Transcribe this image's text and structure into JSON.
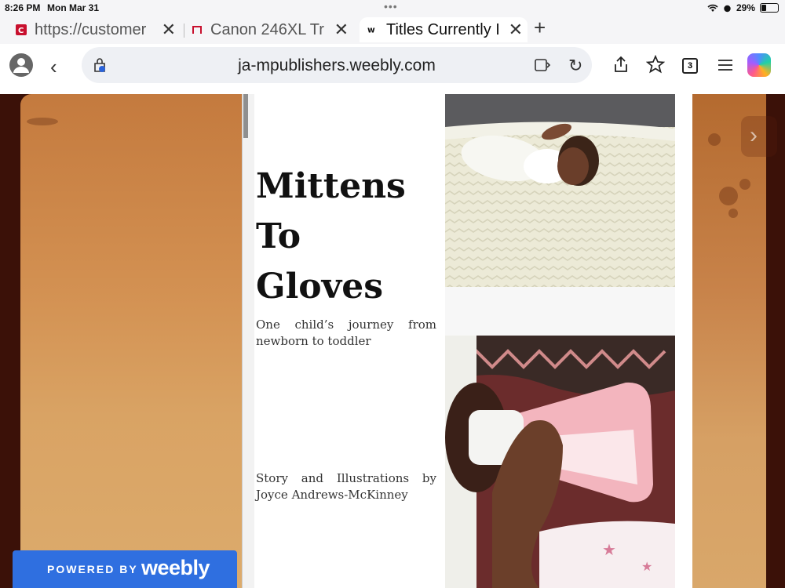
{
  "status_bar": {
    "time": "8:26 PM",
    "date": "Mon Mar 31",
    "battery": "29%",
    "battery_fraction": 0.29
  },
  "tabs": [
    {
      "title": "https://customer",
      "active": false
    },
    {
      "title": "Canon 246XL Tr",
      "active": false
    },
    {
      "title": "Titles Currently I",
      "active": true
    }
  ],
  "address_bar": {
    "url": "ja-mpublishers.weebly.com",
    "tab_count": "3"
  },
  "cover": {
    "title_lines": [
      "Mittens",
      "To",
      "Gloves"
    ],
    "subtitle": "One child’s journey from newborn to toddler",
    "credit": "Story and Illustrations by Joyce Andrews-McKinney"
  },
  "footer": {
    "powered_by": "POWERED BY",
    "brand": "weebly"
  },
  "colors": {
    "weebly_blue": "#2f6fe0",
    "parchment": "#d39152",
    "background": "#3b1108"
  }
}
